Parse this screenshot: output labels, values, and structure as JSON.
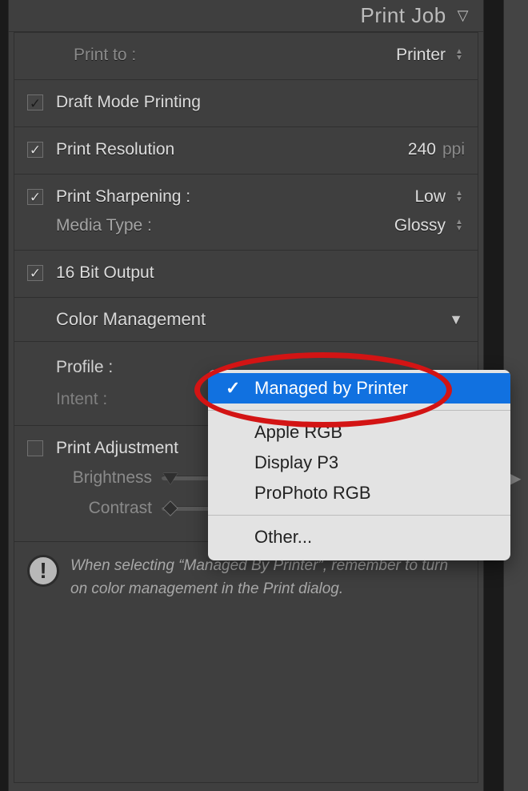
{
  "panel": {
    "title": "Print Job"
  },
  "print_to": {
    "label": "Print to :",
    "value": "Printer"
  },
  "draft_mode": {
    "label": "Draft Mode Printing",
    "checked": false
  },
  "resolution": {
    "label": "Print Resolution",
    "checked": true,
    "value": "240",
    "unit": "ppi"
  },
  "sharpening": {
    "label": "Print Sharpening :",
    "checked": true,
    "value": "Low",
    "media_label": "Media Type :",
    "media_value": "Glossy"
  },
  "sixteen_bit": {
    "label": "16 Bit Output",
    "checked": true
  },
  "color_mgmt": {
    "header": "Color Management",
    "profile_label": "Profile :",
    "intent_label": "Intent :"
  },
  "adjustment": {
    "label": "Print Adjustment",
    "checked": false,
    "brightness_label": "Brightness",
    "contrast_label": "Contrast"
  },
  "info": {
    "text": "When selecting “Managed By Printer”, remember to turn on color management in the Print dialog."
  },
  "dropdown": {
    "selected": "Managed by Printer",
    "items": [
      "Apple RGB",
      "Display P3",
      "ProPhoto RGB"
    ],
    "other": "Other..."
  }
}
